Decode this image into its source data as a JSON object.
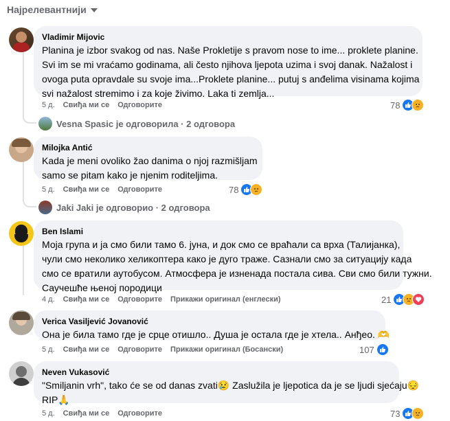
{
  "sort_label": "Најрелевантнији",
  "comments": [
    {
      "name": "Vladimir Mijovic",
      "lines": [
        "Planina je izbor svakog od nas. Naše Prokletije s pravom nose to ime... proklete planine.",
        "Svi im se mi vraćamo godinama, ali često njihova ljepota uzima i svoj danak. Nažalost i",
        "ovoga puta opravdale su svoje ima...Proklete planine... putuj s anđelima visinama kojima",
        "svi nažalost stremimo i za koje živimo. Laka ti zemlja..."
      ],
      "time": "5 д.",
      "like": "Свиђа ми се",
      "reply": "Одговорите",
      "translate": "",
      "count": "78",
      "reactions": [
        "like",
        "sad"
      ]
    },
    {
      "name": "Milojka Antić",
      "lines": [
        "Kada je meni ovoliko žao danima o njoj razmišljam",
        "samo se pitam kako je njenim roditeljima."
      ],
      "time": "5 д.",
      "like": "Свиђа ми се",
      "reply": "Одговорите",
      "translate": "",
      "count": "78",
      "reactions": [
        "like",
        "sad"
      ]
    },
    {
      "name": "Ben Islami",
      "lines": [
        "Моја група и ја смо били тамо 6. јуна, и док смо се враћали са врха (Талијанка),",
        "чули смо неколико хеликоптера како је дуго траже. Сазнали смо за ситуацију када",
        "смо се вратили аутобусом. Атмосфера је изненада постала сива. Сви смо били тужни.",
        "Саучешће њеној породици"
      ],
      "time": "4 д.",
      "like": "Свиђа ми се",
      "reply": "Одговорите",
      "translate": "Прикажи оригинал (енглески)",
      "count": "21",
      "reactions": [
        "like",
        "sad",
        "love"
      ]
    },
    {
      "name": "Verica Vasiljević Jovanović",
      "lines": [
        "Она је била тамо где је срце отишло.. Душа је остала где је хтела.. Анђео. 🫶"
      ],
      "time": "5 д.",
      "like": "Свиђа ми се",
      "reply": "Одговорите",
      "translate": "Прикажи оригинал (Босански)",
      "count": "107",
      "reactions": [
        "like"
      ]
    },
    {
      "name": "Neven Vukasović",
      "lines": [
        "\"Smiljanin vrh\", tako će se od danas zvati😢 Zaslužila je ljepotica da je se ljudi sjećaju😔",
        "RIP🙏"
      ],
      "time": "5 д.",
      "like": "Свиђа ми се",
      "reply": "Одговорите",
      "translate": "",
      "count": "73",
      "reactions": [
        "like",
        "sad"
      ]
    }
  ],
  "replies": [
    {
      "text": "Vesna Spasic је одговорила · 2 одговора"
    },
    {
      "text": "Jaki Jaki је одговорио · 2 одговора"
    }
  ],
  "colors": {
    "bubble": "#f0f2f5",
    "meta": "#65676b",
    "like": "#1877f2",
    "sad": "#f7b125",
    "love": "#f33e58"
  }
}
